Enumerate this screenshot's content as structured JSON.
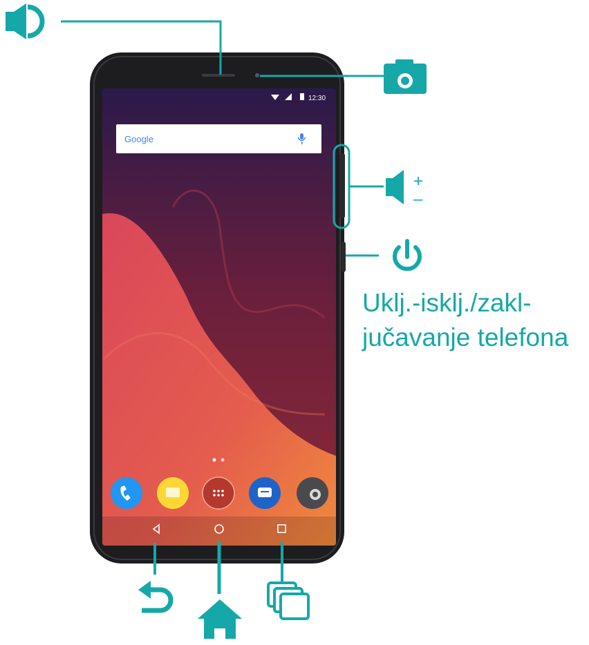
{
  "accent_color": "#16a8a8",
  "status_bar": {
    "time": "12:30"
  },
  "search_widget": {
    "logo_text": "Google"
  },
  "callouts": {
    "earpiece": {
      "icon": "speaker-icon"
    },
    "front_camera": {
      "icon": "camera-icon"
    },
    "volume": {
      "icon": "volume-icon",
      "plus": "+",
      "minus": "–"
    },
    "power": {
      "icon": "power-icon",
      "caption_line1": "Uklj.-isklj./zakl-",
      "caption_line2": "jučavanje telefona"
    },
    "back": {
      "icon": "back-arrow-icon"
    },
    "home": {
      "icon": "home-icon"
    },
    "recents": {
      "icon": "recent-apps-icon"
    }
  },
  "dock_apps": [
    "phone-app-icon",
    "messages-app-icon",
    "app-drawer-icon",
    "chat-app-icon",
    "camera-app-icon"
  ]
}
